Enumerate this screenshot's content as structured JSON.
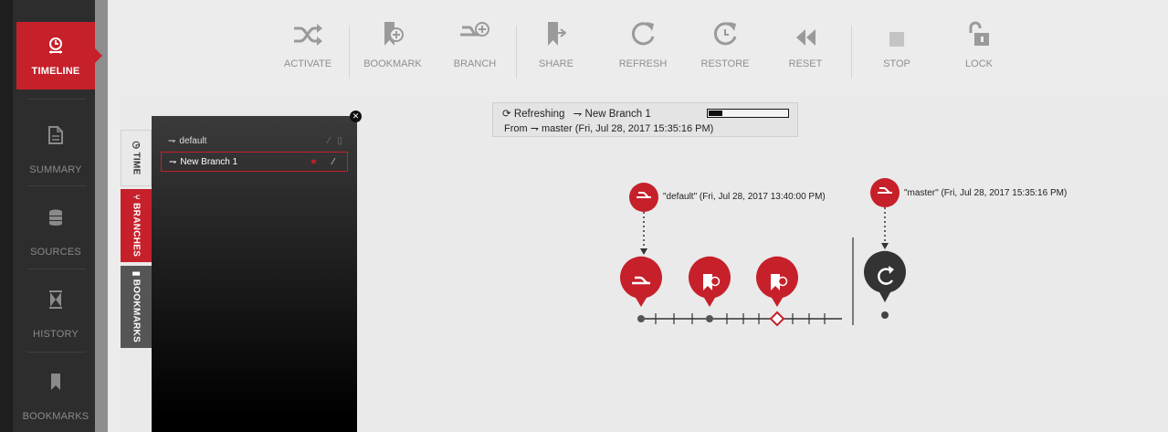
{
  "nav": {
    "items": [
      {
        "label": "TIMELINE",
        "icon": "timeline-icon"
      },
      {
        "label": "SUMMARY",
        "icon": "document-icon"
      },
      {
        "label": "SOURCES",
        "icon": "database-icon"
      },
      {
        "label": "HISTORY",
        "icon": "hourglass-icon"
      },
      {
        "label": "BOOKMARKS",
        "icon": "bookmark-icon"
      }
    ]
  },
  "toolbar": {
    "activate": "ACTIVATE",
    "bookmark": "BOOKMARK",
    "branch": "BRANCH",
    "share": "SHARE",
    "refresh": "REFRESH",
    "restore": "RESTORE",
    "reset": "RESET",
    "stop": "STOP",
    "lock": "LOCK"
  },
  "tabs": {
    "time": "TIME",
    "branches": "BRANCHES",
    "bookmarks": "BOOKMARKS"
  },
  "branches": [
    {
      "name": "default"
    },
    {
      "name": "New Branch 1"
    }
  ],
  "status": {
    "line1_prefix": "Refreshing",
    "branch": "New Branch 1",
    "line2_prefix": "From",
    "source": "master (Fri, Jul 28, 2017 15:35:16 PM)",
    "progress": 0.17
  },
  "timeline": {
    "default_label": "\"default\" (Fri, Jul 28, 2017 13:40:00 PM)",
    "master_label": "\"master\" (Fri, Jul 28, 2017 15:35:16 PM)"
  },
  "colors": {
    "accent": "#c6202a",
    "nav_bg": "#2d2d2d",
    "toolbar_text": "#8f8f8f"
  }
}
